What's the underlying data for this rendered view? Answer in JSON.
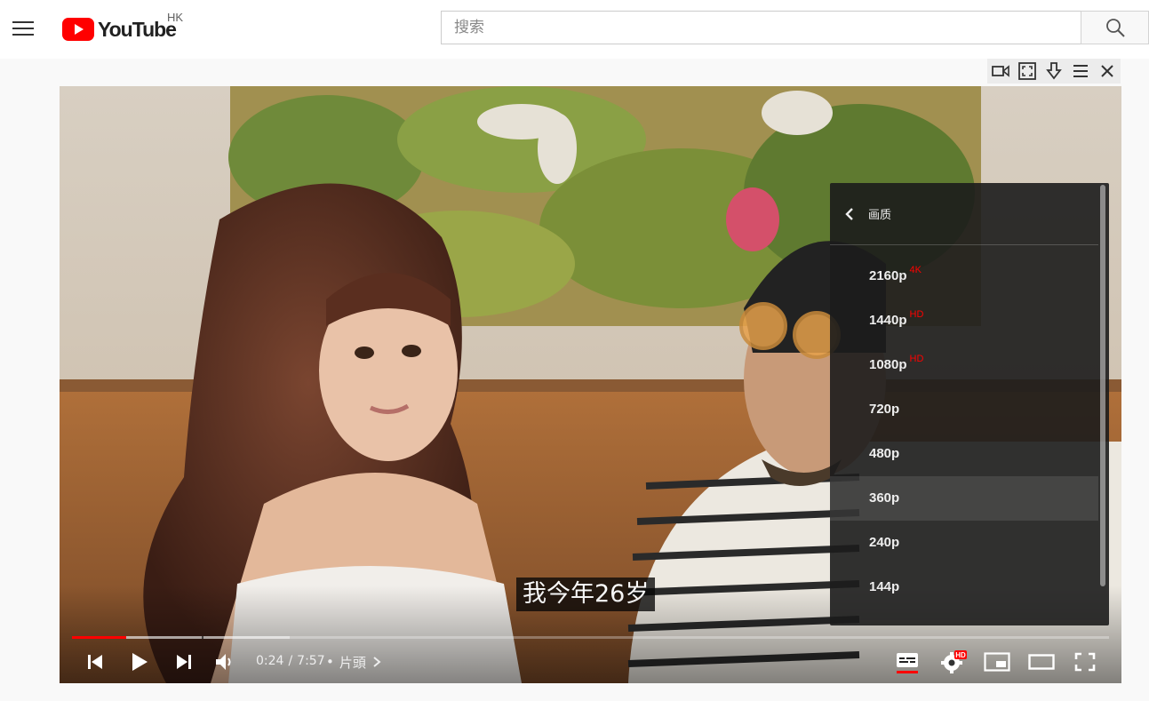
{
  "header": {
    "logo_text": "YouTube",
    "region": "HK",
    "search_placeholder": "搜索"
  },
  "player": {
    "subtitle": "我今年26岁",
    "current_time": "0:24",
    "time_separator": "/",
    "duration": "7:57",
    "chapter_bullet": "•",
    "chapter_label": "片頭",
    "progress_played_fraction": 0.052,
    "progress_buffered_fraction": 0.21,
    "settings_badge": "HD"
  },
  "quality_menu": {
    "title": "画质",
    "options": [
      {
        "label": "2160p",
        "badge": "4K"
      },
      {
        "label": "1440p",
        "badge": "HD"
      },
      {
        "label": "1080p",
        "badge": "HD"
      },
      {
        "label": "720p",
        "badge": ""
      },
      {
        "label": "480p",
        "badge": ""
      },
      {
        "label": "360p",
        "badge": ""
      },
      {
        "label": "240p",
        "badge": ""
      },
      {
        "label": "144p",
        "badge": ""
      }
    ],
    "highlighted": "360p"
  },
  "colors": {
    "brand_red": "#ff0000",
    "menu_bg": "#1c1c1c",
    "badge_red": "#ff0000"
  }
}
